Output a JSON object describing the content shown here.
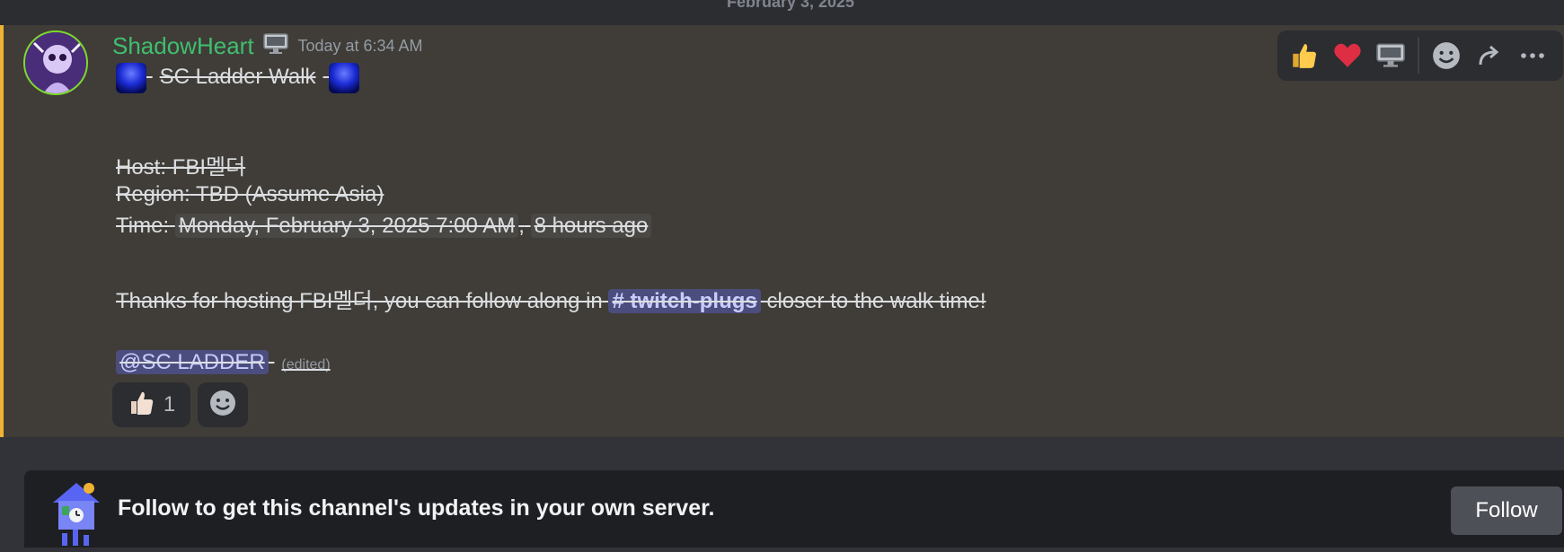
{
  "date_divider": "February 3, 2025",
  "message": {
    "username": "ShadowHeart",
    "timestamp": "Today at 6:34 AM",
    "title": "SC Ladder Walk",
    "host_label": "Host:",
    "host_value": "FBI멜더",
    "region_label": "Region:",
    "region_value": "TBD (Assume Asia)",
    "time_label": "Time:",
    "time_value": "Monday, February 3, 2025 7:00 AM",
    "time_sep": ",",
    "time_relative": "8 hours ago",
    "thanks_prefix": "Thanks for hosting FBI멜더, you can follow along in",
    "channel_mention": "# twitch-plugs",
    "thanks_suffix": "closer to the walk time!",
    "role_mention": "@SC LADDER",
    "edited": "(edited)",
    "reactions": [
      {
        "emoji": "thumbs-up-icon",
        "count": "1"
      },
      {
        "emoji": "add-reaction-icon",
        "count": ""
      }
    ]
  },
  "toolbar": {
    "buttons": [
      "thumbs-up-icon",
      "heart-icon",
      "monitor-icon",
      "add-reaction-icon",
      "reply-arrow-icon",
      "more-icon"
    ]
  },
  "follow_bar": {
    "text": "Follow to get this channel's updates in your own server.",
    "button_label": "Follow"
  },
  "colors": {
    "username": "#3fbf6f",
    "highlight_border": "#f0b232",
    "mention_bg": "#4b4d7e"
  }
}
